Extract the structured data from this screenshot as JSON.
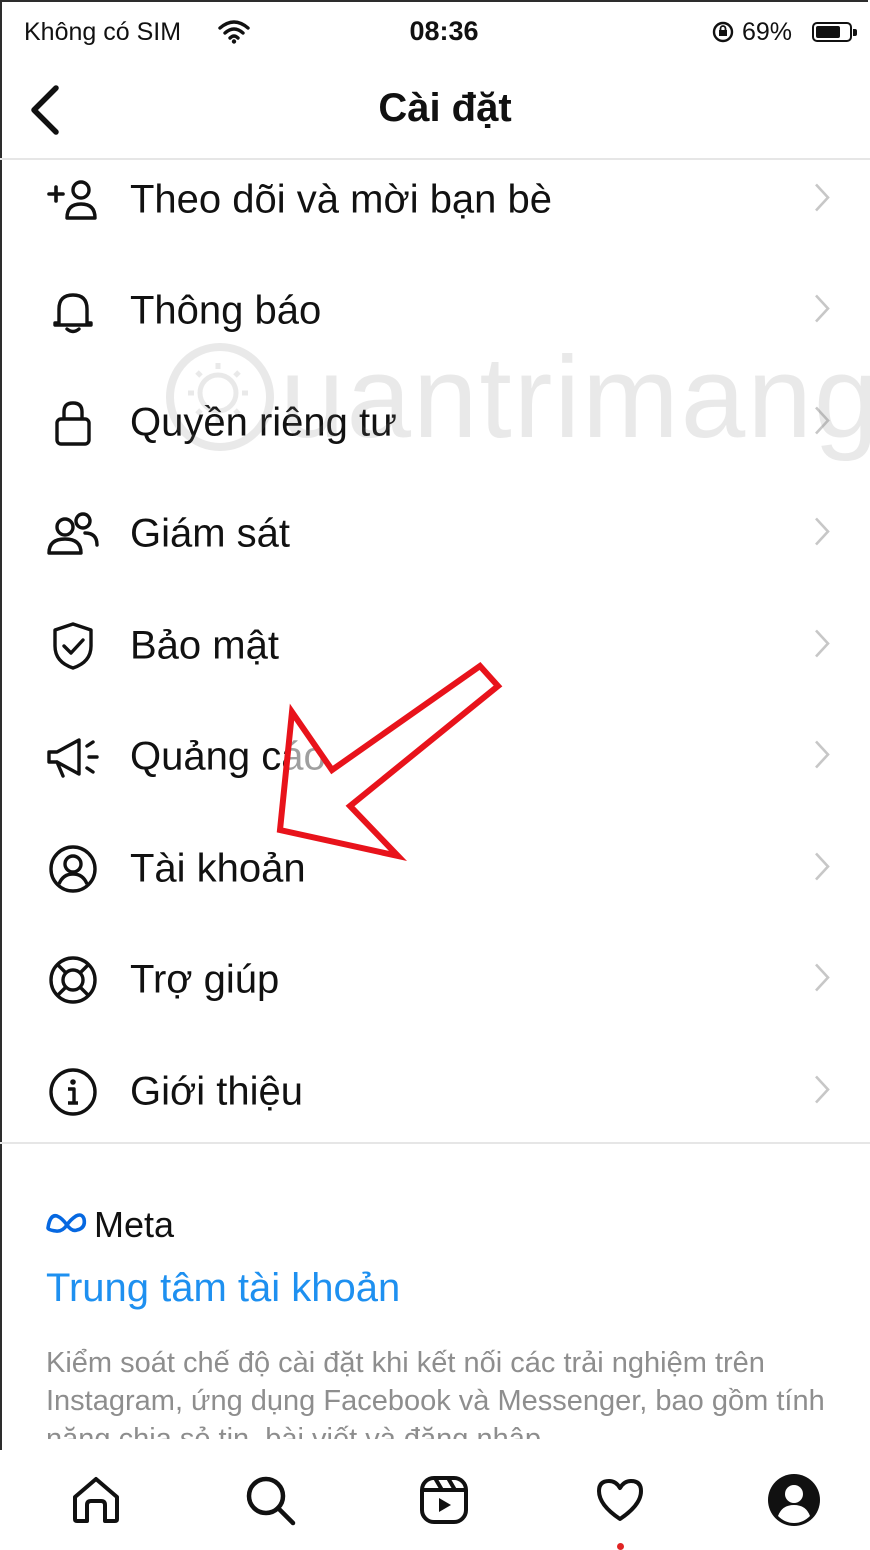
{
  "status_bar": {
    "carrier": "Không có SIM",
    "time": "08:36",
    "battery_percent": "69%"
  },
  "header": {
    "title": "Cài đặt"
  },
  "menu": {
    "items": [
      {
        "label": "Theo dõi và mời bạn bè",
        "icon": "add-person-icon"
      },
      {
        "label": "Thông báo",
        "icon": "bell-icon"
      },
      {
        "label": "Quyền riêng tư",
        "icon": "lock-icon"
      },
      {
        "label": "Giám sát",
        "icon": "people-icon"
      },
      {
        "label": "Bảo mật",
        "icon": "shield-check-icon"
      },
      {
        "label": "Quảng cáo",
        "icon": "megaphone-icon"
      },
      {
        "label": "Tài khoản",
        "icon": "account-circle-icon"
      },
      {
        "label": "Trợ giúp",
        "icon": "lifebuoy-icon"
      },
      {
        "label": "Giới thiệu",
        "icon": "info-icon"
      }
    ]
  },
  "meta_section": {
    "brand": "Meta",
    "accounts_center_link": "Trung tâm tài khoản",
    "description": "Kiểm soát chế độ cài đặt khi kết nối các trải nghiệm trên Instagram, ứng dụng Facebook và Messenger, bao gồm tính năng chia sẻ tin, bài viết và đăng nhập"
  },
  "watermark": "uantrimang",
  "tab_bar": {
    "tabs": [
      "home-icon",
      "search-icon",
      "reels-icon",
      "heart-icon",
      "profile-icon"
    ]
  },
  "colors": {
    "link": "#1e90f0",
    "meta_logo": "#0668e1",
    "annotation_arrow": "#e8131b",
    "secondary_text": "#8e8e8e"
  }
}
